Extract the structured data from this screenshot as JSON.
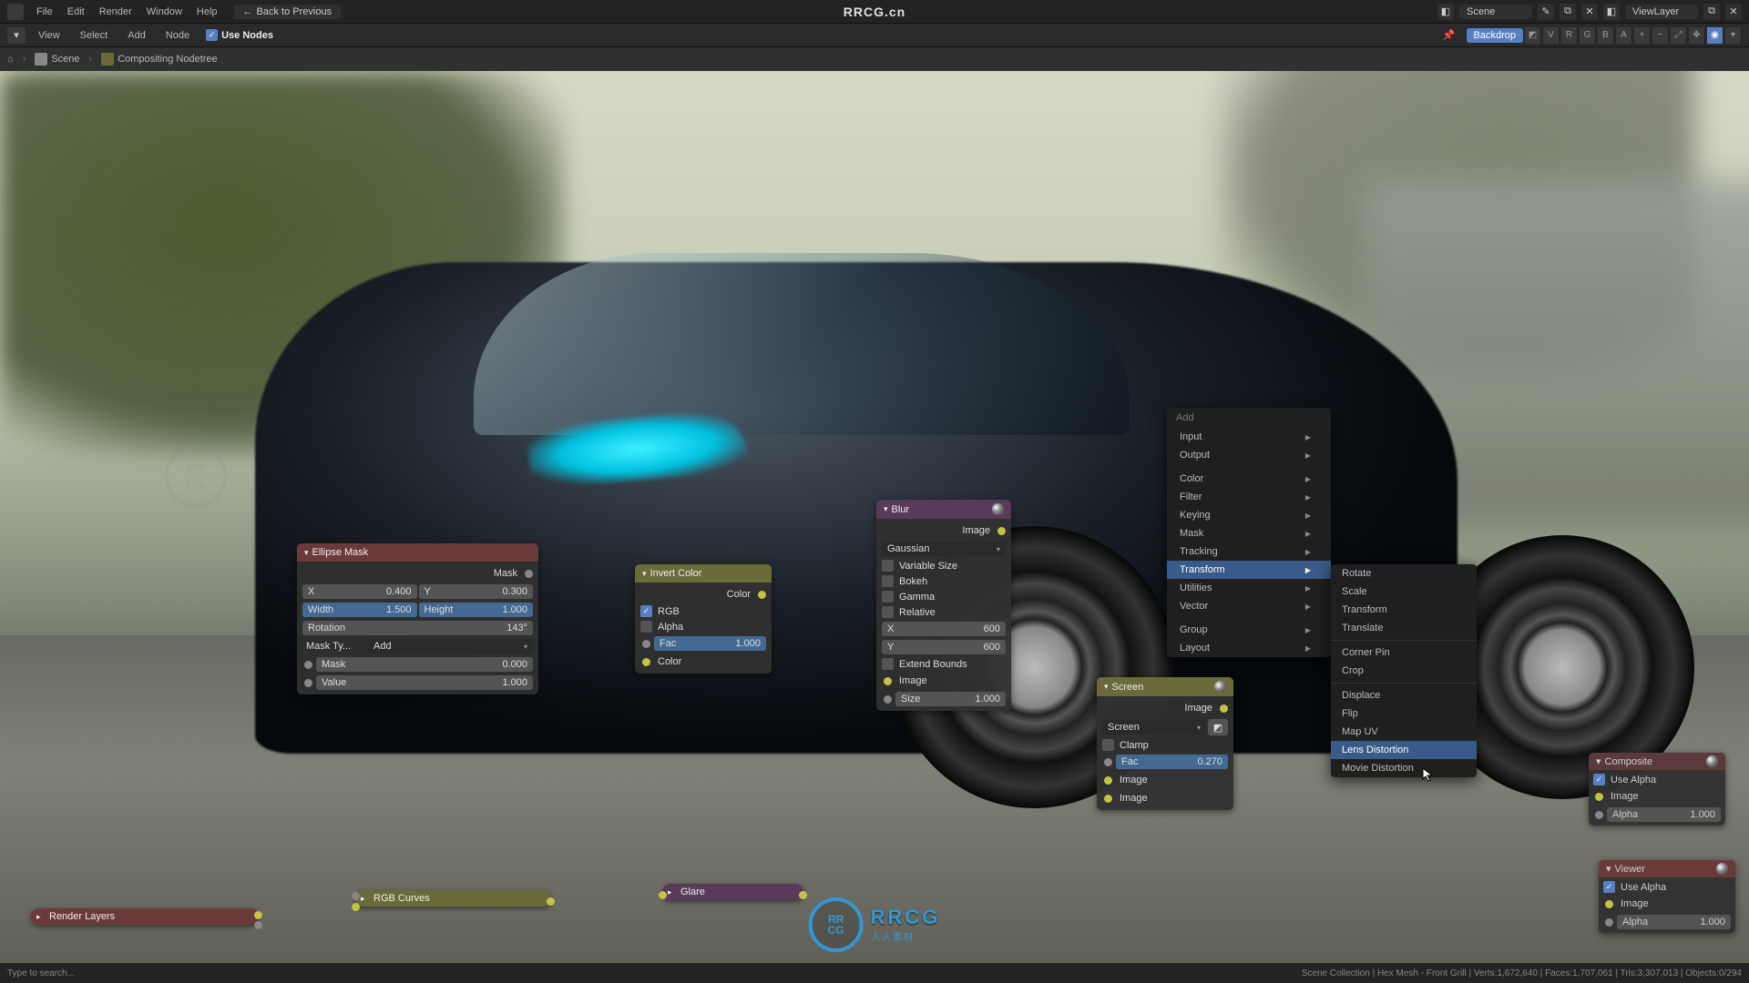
{
  "app_title": "RRCG.cn",
  "topbar": {
    "menus": [
      "File",
      "Edit",
      "Render",
      "Window",
      "Help"
    ],
    "back": "Back to Previous",
    "scene": "Scene",
    "viewlayer": "ViewLayer"
  },
  "secondbar": {
    "menus": [
      "View",
      "Select",
      "Add",
      "Node"
    ],
    "use_nodes": "Use Nodes",
    "backdrop": "Backdrop",
    "channels": [
      "V",
      "R",
      "G",
      "B",
      "A"
    ]
  },
  "breadcrumb": {
    "scene": "Scene",
    "nodetree": "Compositing Nodetree"
  },
  "nodes": {
    "ellipse_mask": {
      "title": "Ellipse Mask",
      "out_mask": "Mask",
      "x_label": "X",
      "x_val": "0.400",
      "y_label": "Y",
      "y_val": "0.300",
      "width_label": "Width",
      "width_val": "1.500",
      "height_label": "Height",
      "height_val": "1.000",
      "rotation_label": "Rotation",
      "rotation_val": "143°",
      "masktype_label": "Mask Ty...",
      "masktype_val": "Add",
      "mask_label": "Mask",
      "mask_val": "0.000",
      "value_label": "Value",
      "value_val": "1.000"
    },
    "invert_color": {
      "title": "Invert Color",
      "out_color": "Color",
      "rgb": "RGB",
      "alpha": "Alpha",
      "fac_label": "Fac",
      "fac_val": "1.000",
      "in_color": "Color"
    },
    "blur": {
      "title": "Blur",
      "out_image": "Image",
      "type": "Gaussian",
      "variable_size": "Variable Size",
      "bokeh": "Bokeh",
      "gamma": "Gamma",
      "relative": "Relative",
      "x_label": "X",
      "x_val": "600",
      "y_label": "Y",
      "y_val": "600",
      "extend": "Extend Bounds",
      "in_image": "Image",
      "size_label": "Size",
      "size_val": "1.000"
    },
    "screen": {
      "title": "Screen",
      "out_image": "Image",
      "mode": "Screen",
      "clamp": "Clamp",
      "fac_label": "Fac",
      "fac_val": "0.270",
      "in_image1": "Image",
      "in_image2": "Image"
    },
    "composite": {
      "title": "Composite",
      "use_alpha": "Use Alpha",
      "image": "Image",
      "alpha_label": "Alpha",
      "alpha_val": "1.000"
    },
    "viewer": {
      "title": "Viewer",
      "use_alpha": "Use Alpha",
      "image": "Image",
      "alpha_label": "Alpha",
      "alpha_val": "1.000"
    },
    "render_layers": "Render Layers",
    "rgb_curves": "RGB Curves",
    "glare": "Glare"
  },
  "add_menu": {
    "title": "Add",
    "items": [
      "Input",
      "Output",
      "Color",
      "Filter",
      "Keying",
      "Mask",
      "Tracking",
      "Transform",
      "Utilities",
      "Vector",
      "Group",
      "Layout"
    ]
  },
  "transform_submenu": {
    "items": [
      "Rotate",
      "Scale",
      "Transform",
      "Translate",
      "Corner Pin",
      "Crop",
      "Displace",
      "Flip",
      "Map UV",
      "Lens Distortion",
      "Movie Distortion"
    ]
  },
  "statusbar": {
    "left": "Type to search...",
    "right": "Scene Collection | Hex Mesh - Front Grill | Verts:1,672,640 | Faces:1,707,061 | Tris:3,307,013 | Objects:0/294"
  },
  "watermark": {
    "brand": "RRCG",
    "tag": "人人素材"
  }
}
